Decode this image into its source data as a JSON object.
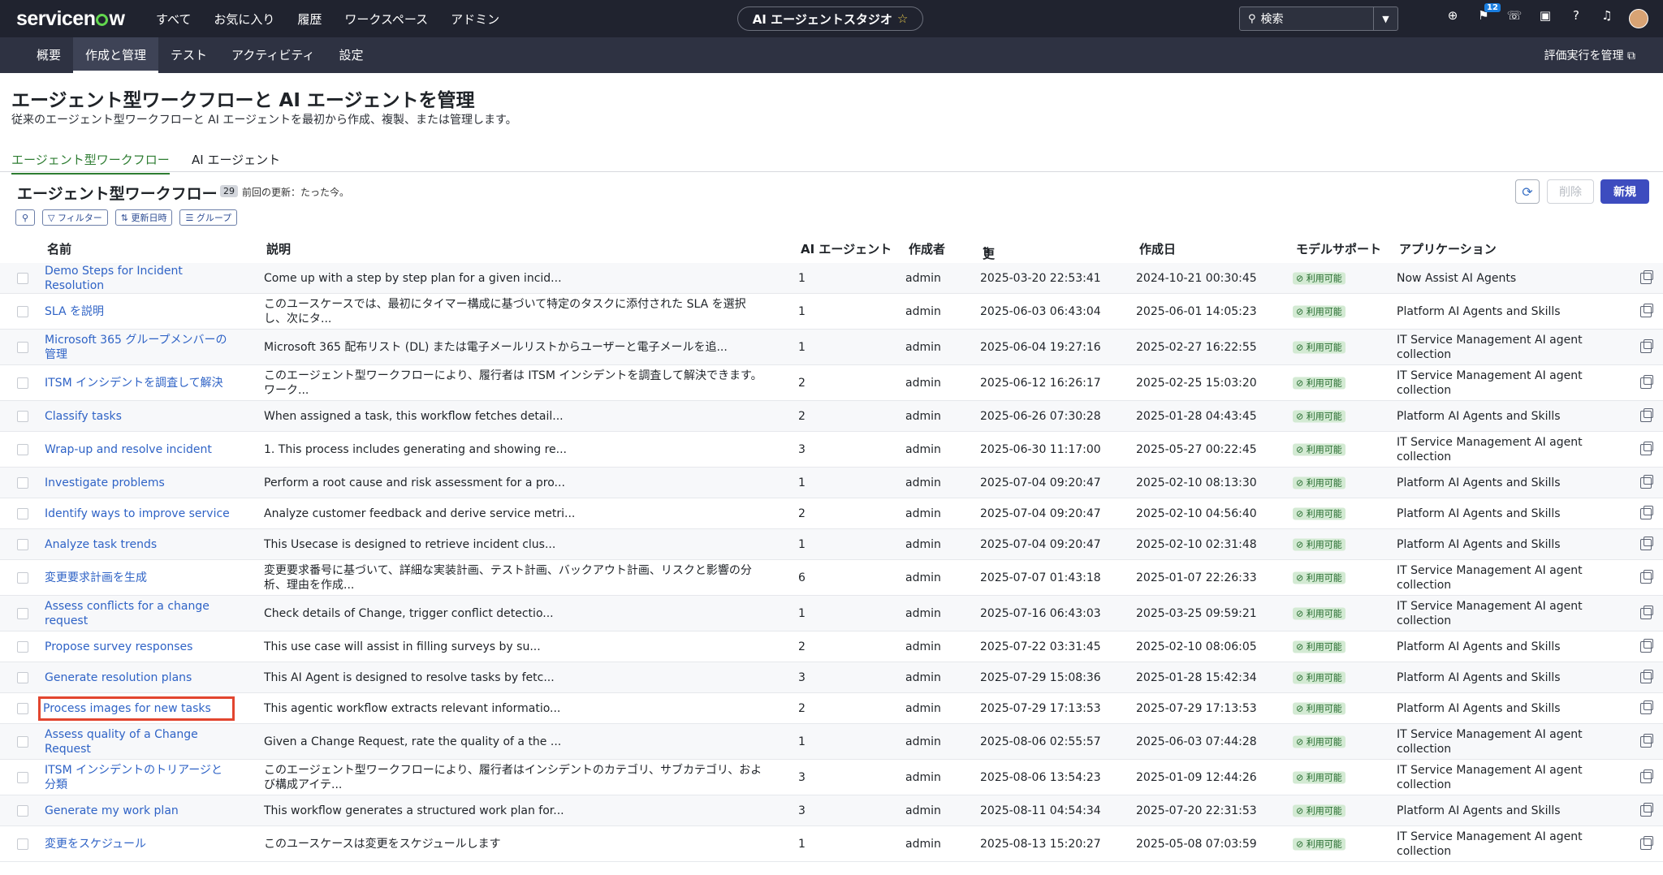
{
  "topbar": {
    "logo": "servicenow",
    "nav": [
      "すべて",
      "お気に入り",
      "履歴",
      "ワークスペース",
      "アドミン"
    ],
    "studio_title": "AI エージェントスタジオ",
    "search_placeholder": "検索",
    "notification_count": "12"
  },
  "subnav": {
    "tabs": [
      "概要",
      "作成と管理",
      "テスト",
      "アクティビティ",
      "設定"
    ],
    "active_tab": "作成と管理",
    "right_link": "評価実行を管理"
  },
  "page": {
    "title": "エージェント型ワークフローと AI エージェントを管理",
    "subtitle": "従来のエージェント型ワークフローと AI エージェントを最初から作成、複製、または管理します。",
    "tabs": [
      "エージェント型ワークフロー",
      "AI エージェント"
    ]
  },
  "list": {
    "title": "エージェント型ワークフロー",
    "count": "29",
    "last_updated": "前回の更新：たった今。",
    "delete_label": "削除",
    "new_label": "新規",
    "filter_label": "フィルター",
    "sort_label": "更新日時",
    "group_label": "グループ"
  },
  "table": {
    "columns": [
      "名前",
      "説明",
      "AI エージェント",
      "作成者",
      "更新日",
      "作成日",
      "モデルサポート",
      "アプリケーション"
    ],
    "status_label": "利用可能",
    "rows": [
      {
        "name": "Demo Steps for Incident Resolution",
        "description": "Come up with a step by step plan for a given incid...",
        "agents": "1",
        "created_by": "admin",
        "updated": "2025-03-20 22:53:41",
        "created": "2024-10-21 00:30:45",
        "application": "Now Assist AI Agents"
      },
      {
        "name": "SLA を説明",
        "description": "このユースケースでは、最初にタイマー構成に基づいて特定のタスクに添付された SLA を選択し、次にタ...",
        "agents": "1",
        "created_by": "admin",
        "updated": "2025-06-03 06:43:04",
        "created": "2025-06-01 14:05:23",
        "application": "Platform AI Agents and Skills"
      },
      {
        "name": "Microsoft 365 グループメンバーの管理",
        "description": "Microsoft 365 配布リスト (DL) または電子メールリストからユーザーと電子メールを追...",
        "agents": "1",
        "created_by": "admin",
        "updated": "2025-06-04 19:27:16",
        "created": "2025-02-27 16:22:55",
        "application": "IT Service Management AI agent collection"
      },
      {
        "name": "ITSM インシデントを調査して解決",
        "description": "このエージェント型ワークフローにより、履行者は ITSM インシデントを調査して解決できます。ワーク...",
        "agents": "2",
        "created_by": "admin",
        "updated": "2025-06-12 16:26:17",
        "created": "2025-02-25 15:03:20",
        "application": "IT Service Management AI agent collection"
      },
      {
        "name": "Classify tasks",
        "description": "When assigned a task, this workflow fetches detail...",
        "agents": "2",
        "created_by": "admin",
        "updated": "2025-06-26 07:30:28",
        "created": "2025-01-28 04:43:45",
        "application": "Platform AI Agents and Skills"
      },
      {
        "name": "Wrap-up and resolve incident",
        "description": "1. This process includes generating and showing re...",
        "agents": "3",
        "created_by": "admin",
        "updated": "2025-06-30 11:17:00",
        "created": "2025-05-27 00:22:45",
        "application": "IT Service Management AI agent collection"
      },
      {
        "name": "Investigate problems",
        "description": "Perform a root cause and risk assessment for a pro...",
        "agents": "1",
        "created_by": "admin",
        "updated": "2025-07-04 09:20:47",
        "created": "2025-02-10 08:13:30",
        "application": "Platform AI Agents and Skills"
      },
      {
        "name": "Identify ways to improve service",
        "description": "Analyze customer feedback and derive service metri...",
        "agents": "2",
        "created_by": "admin",
        "updated": "2025-07-04 09:20:47",
        "created": "2025-02-10 04:56:40",
        "application": "Platform AI Agents and Skills"
      },
      {
        "name": "Analyze task trends",
        "description": "This Usecase is designed to retrieve incident clus...",
        "agents": "1",
        "created_by": "admin",
        "updated": "2025-07-04 09:20:47",
        "created": "2025-02-10 02:31:48",
        "application": "Platform AI Agents and Skills"
      },
      {
        "name": "変更要求計画を生成",
        "description": "変更要求番号に基づいて、詳細な実装計画、テスト計画、バックアウト計画、リスクと影響の分析、理由を作成...",
        "agents": "6",
        "created_by": "admin",
        "updated": "2025-07-07 01:43:18",
        "created": "2025-01-07 22:26:33",
        "application": "IT Service Management AI agent collection"
      },
      {
        "name": "Assess conflicts for a change request",
        "description": "Check details of Change, trigger conflict detectio...",
        "agents": "1",
        "created_by": "admin",
        "updated": "2025-07-16 06:43:03",
        "created": "2025-03-25 09:59:21",
        "application": "IT Service Management AI agent collection"
      },
      {
        "name": "Propose survey responses",
        "description": "This use case will assist in filling surveys by su...",
        "agents": "2",
        "created_by": "admin",
        "updated": "2025-07-22 03:31:45",
        "created": "2025-02-10 08:06:05",
        "application": "Platform AI Agents and Skills"
      },
      {
        "name": "Generate resolution plans",
        "description": "This AI Agent is designed to resolve tasks by fetc...",
        "agents": "3",
        "created_by": "admin",
        "updated": "2025-07-29 15:08:36",
        "created": "2025-01-28 15:42:34",
        "application": "Platform AI Agents and Skills"
      },
      {
        "name": "Process images for new tasks",
        "description": "This agentic workflow extracts relevant informatio...",
        "agents": "2",
        "created_by": "admin",
        "updated": "2025-07-29 17:13:53",
        "created": "2025-07-29 17:13:53",
        "application": "Platform AI Agents and Skills"
      },
      {
        "name": "Assess quality of a Change Request",
        "description": "Given a Change Request, rate the quality of a the ...",
        "agents": "1",
        "created_by": "admin",
        "updated": "2025-08-06 02:55:57",
        "created": "2025-06-03 07:44:28",
        "application": "IT Service Management AI agent collection"
      },
      {
        "name": "ITSM インシデントのトリアージと分類",
        "description": "このエージェント型ワークフローにより、履行者はインシデントのカテゴリ、サブカテゴリ、および構成アイテ...",
        "agents": "3",
        "created_by": "admin",
        "updated": "2025-08-06 13:54:23",
        "created": "2025-01-09 12:44:26",
        "application": "IT Service Management AI agent collection"
      },
      {
        "name": "Generate my work plan",
        "description": "This workflow generates a structured work plan for...",
        "agents": "3",
        "created_by": "admin",
        "updated": "2025-08-11 04:54:34",
        "created": "2025-07-20 22:31:53",
        "application": "Platform AI Agents and Skills"
      },
      {
        "name": "変更をスケジュール",
        "description": "このユースケースは変更をスケジュールします",
        "agents": "1",
        "created_by": "admin",
        "updated": "2025-08-13 15:20:27",
        "created": "2025-05-08 07:03:59",
        "application": "IT Service Management AI agent collection"
      }
    ]
  }
}
